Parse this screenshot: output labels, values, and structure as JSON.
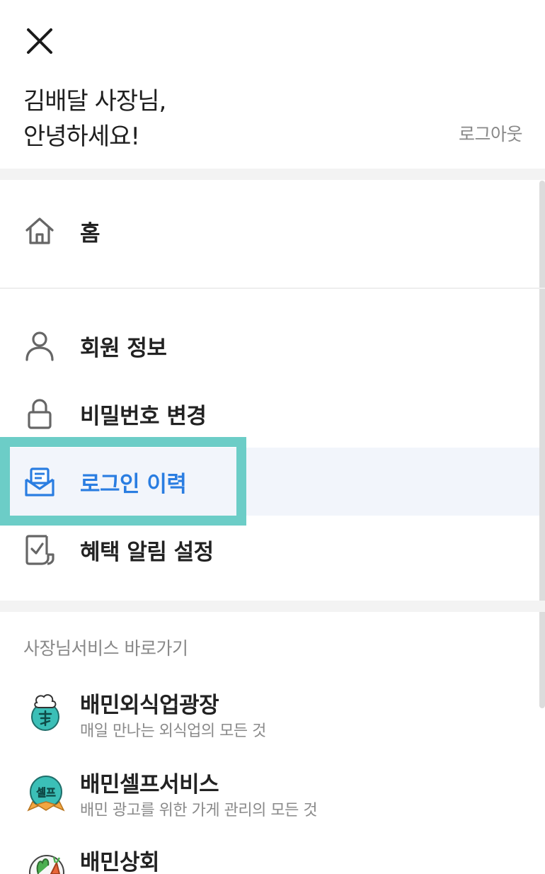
{
  "header": {
    "greeting_line1": "김배달 사장님,",
    "greeting_line2": "안녕하세요!",
    "logout_label": "로그아웃"
  },
  "menu": {
    "home": {
      "label": "홈",
      "icon": "home-icon"
    },
    "items": [
      {
        "label": "회원 정보",
        "icon": "user-icon",
        "active": false
      },
      {
        "label": "비밀번호 변경",
        "icon": "lock-icon",
        "active": false
      },
      {
        "label": "로그인 이력",
        "icon": "mail-open-icon",
        "active": true
      },
      {
        "label": "혜택 알림 설정",
        "icon": "checklist-icon",
        "active": false
      }
    ]
  },
  "services": {
    "heading": "사장님서비스 바로가기",
    "items": [
      {
        "title": "배민외식업광장",
        "desc": "매일 만나는 외식업의 모든 것",
        "icon": "chef-hat-logo-icon"
      },
      {
        "title": "배민셀프서비스",
        "desc": "배민 광고를 위한 가게 관리의 모든 것",
        "icon": "self-service-logo-icon",
        "badge": "셀프"
      },
      {
        "title": "배민상회",
        "desc": "",
        "icon": "vegetables-logo-icon"
      }
    ]
  },
  "colors": {
    "active_text": "#2a7de1",
    "active_bg": "#f2f5fb",
    "highlight_border": "#6ccdc7",
    "muted_text": "#888888",
    "logo_teal": "#3bbfb7"
  }
}
